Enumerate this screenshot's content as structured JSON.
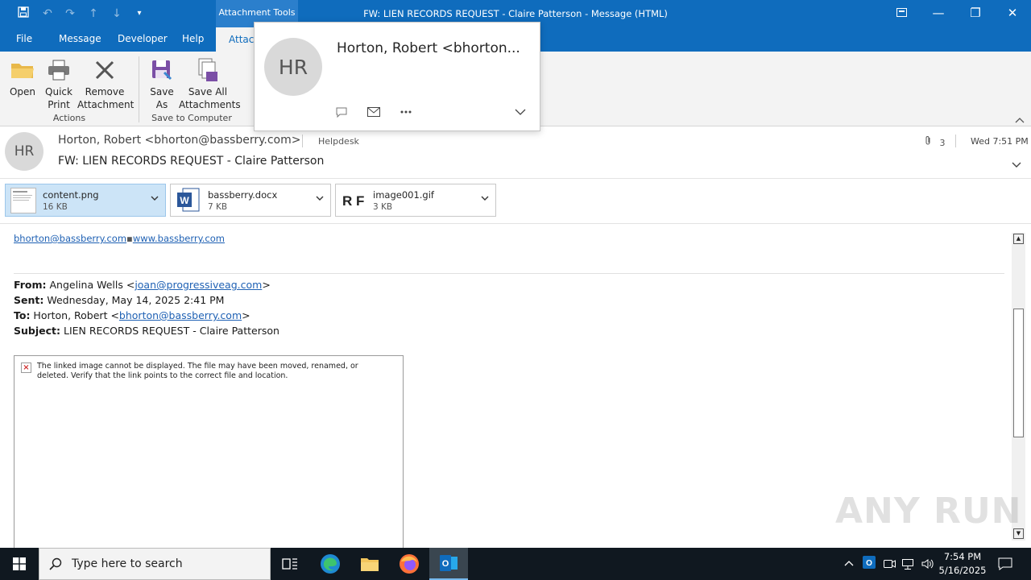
{
  "titlebar": {
    "context_tab": "Attachment Tools",
    "title": "FW: LIEN RECORDS REQUEST - Claire Patterson  -  Message (HTML)"
  },
  "menu": {
    "file": "File",
    "message": "Message",
    "developer": "Developer",
    "help": "Help",
    "attachments_tab": "Attach"
  },
  "ribbon": {
    "open": "Open",
    "quick_print_1": "Quick",
    "quick_print_2": "Print",
    "remove_1": "Remove",
    "remove_2": "Attachment",
    "group_actions": "Actions",
    "save_as_1": "Save",
    "save_as_2": "As",
    "save_all_1": "Save All",
    "save_all_2": "Attachments",
    "group_save": "Save to Computer"
  },
  "header": {
    "avatar_initials": "HR",
    "sender": "Horton, Robert <bhorton@bassberry.com>",
    "folder": "Helpdesk",
    "subject": "FW: LIEN RECORDS REQUEST - Claire Patterson",
    "attachment_count": "3",
    "received": "Wed 7:51 PM"
  },
  "attachments": [
    {
      "name": "content.png",
      "size": "16 KB",
      "icon": "image-thumbnail-icon"
    },
    {
      "name": "bassberry.docx",
      "size": "7 KB",
      "icon": "word-doc-icon"
    },
    {
      "name": "image001.gif",
      "size": "3 KB",
      "icon": "gif-thumbnail-icon"
    }
  ],
  "body": {
    "link_email": "bhorton@bassberry.com",
    "link_sep": "▪",
    "link_web": "www.bassberry.com",
    "from_label": "From:",
    "from_name": " Angelina Wells <",
    "from_email": "joan@progressiveag.com",
    "from_close": ">",
    "sent_label": "Sent:",
    "sent_value": " Wednesday, May 14, 2025  2:41 PM",
    "to_label": "To:",
    "to_name": " Horton, Robert <",
    "to_email": "bhorton@bassberry.com",
    "to_close": ">",
    "subject_label": "Subject:",
    "subject_value": " LIEN RECORDS REQUEST - Claire Patterson",
    "broken_image_text": "The linked image cannot be displayed.  The file may have been moved, renamed, or deleted. Verify that the link points to the correct file and location."
  },
  "contact_card": {
    "initials": "HR",
    "name": "Horton, Robert <bhorton..."
  },
  "watermark": "ANY RUN",
  "taskbar": {
    "search_placeholder": "Type here to search",
    "time": "7:54 PM",
    "date": "5/16/2025"
  },
  "colors": {
    "titlebar": "#0f6cbd",
    "selected_attachment": "#cce4f7",
    "link": "#1f61b4",
    "taskbar": "#101820"
  }
}
